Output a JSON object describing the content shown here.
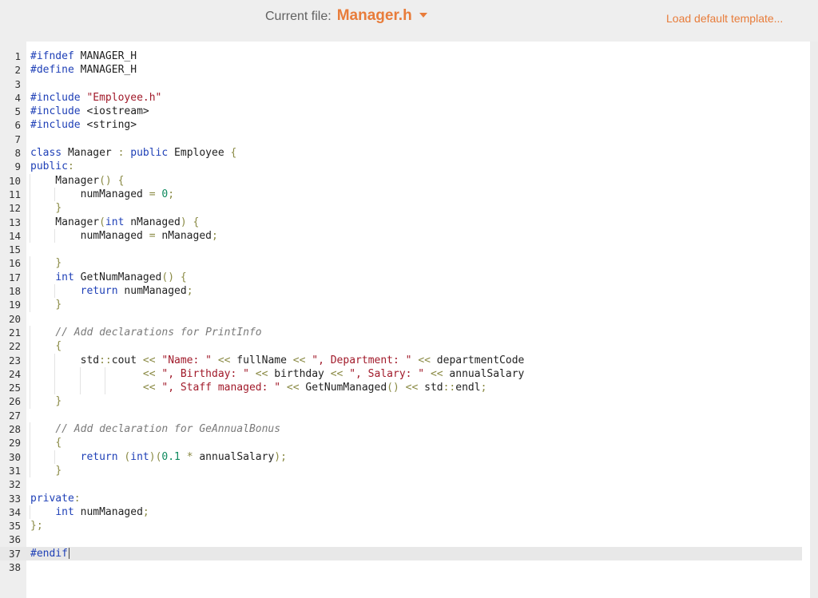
{
  "header": {
    "file_label": "Current file:",
    "file_name": "Manager.h",
    "load_default": "Load default template..."
  },
  "editor": {
    "active_line": 37,
    "lines": [
      "#ifndef MANAGER_H",
      "#define MANAGER_H",
      "",
      "#include \"Employee.h\"",
      "#include <iostream>",
      "#include <string>",
      "",
      "class Manager : public Employee {",
      "public:",
      "    Manager() {",
      "        numManaged = 0;",
      "    }",
      "    Manager(int nManaged) {",
      "        numManaged = nManaged;",
      "",
      "    }",
      "    int GetNumManaged() {",
      "        return numManaged;",
      "    }",
      "",
      "    // Add declarations for PrintInfo",
      "    {",
      "        std::cout << \"Name: \" << fullName << \", Department: \" << departmentCode",
      "                  << \", Birthday: \" << birthday << \", Salary: \" << annualSalary",
      "                  << \", Staff managed: \" << GetNumManaged() << std::endl;",
      "    }",
      "",
      "    // Add declaration for GeAnnualBonus",
      "    {",
      "        return (int)(0.1 * annualSalary);",
      "    }",
      "",
      "private:",
      "    int numManaged;",
      "};",
      "",
      "#endif",
      ""
    ]
  }
}
